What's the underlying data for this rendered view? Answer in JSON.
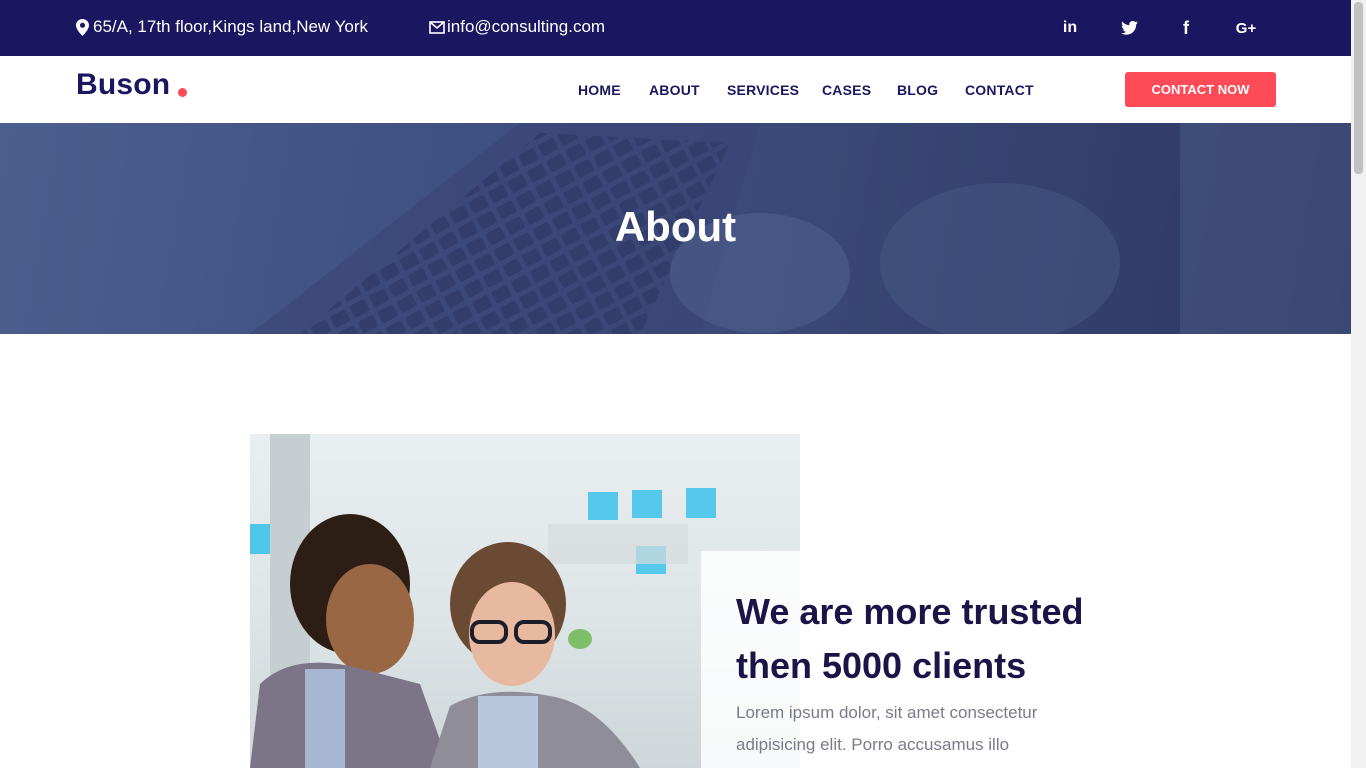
{
  "topbar": {
    "address": "65/A, 17th floor,Kings land,New York",
    "email": "info@consulting.com",
    "socials": [
      {
        "name": "linkedin",
        "label": "in"
      },
      {
        "name": "twitter",
        "label": ""
      },
      {
        "name": "facebook",
        "label": "f"
      },
      {
        "name": "google-plus",
        "label": "G+"
      }
    ]
  },
  "navbar": {
    "logo": "Buson",
    "items": [
      "HOME",
      "ABOUT",
      "SERVICES",
      "CASES",
      "BLOG",
      "CONTACT"
    ],
    "cta": "CONTACT NOW"
  },
  "hero": {
    "title": "About"
  },
  "about": {
    "heading": "We are more trusted then 5000 clients",
    "paragraph": "Lorem ipsum dolor, sit amet consectetur adipisicing elit. Porro accusamus illo"
  },
  "colors": {
    "primary": "#1a1660",
    "accent": "#ff4a57"
  }
}
